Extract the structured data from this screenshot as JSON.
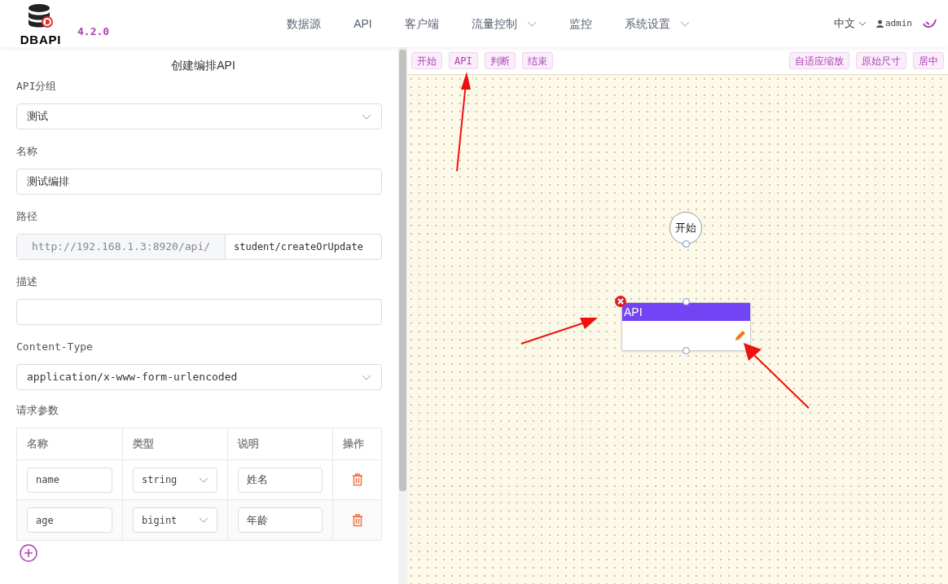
{
  "header": {
    "logo_text": "DBAPI",
    "version": "4.2.0",
    "nav": [
      {
        "label": "数据源",
        "dropdown": false
      },
      {
        "label": "API",
        "dropdown": false
      },
      {
        "label": "客户端",
        "dropdown": false
      },
      {
        "label": "流量控制",
        "dropdown": true
      },
      {
        "label": "监控",
        "dropdown": false
      },
      {
        "label": "系统设置",
        "dropdown": true
      }
    ],
    "language": "中文",
    "user": "admin"
  },
  "form": {
    "title": "创建编排API",
    "fields": [
      {
        "kind": "select",
        "label": "API分组",
        "value": "测试"
      },
      {
        "kind": "input",
        "label": "名称",
        "value": "测试编排"
      },
      {
        "kind": "path",
        "label": "路径",
        "prefix": "http://192.168.1.3:8920/api/",
        "value": "student/createOrUpdate"
      },
      {
        "kind": "input",
        "label": "描述"
      },
      {
        "kind": "select",
        "label": "Content-Type",
        "value": "application/x-www-form-urlencoded"
      }
    ],
    "params_label": "请求参数",
    "params_columns": [
      "名称",
      "类型",
      "说明",
      "操作"
    ],
    "params": [
      {
        "name": "name",
        "type": "string",
        "description": "姓名"
      },
      {
        "name": "age",
        "type": "bigint",
        "description": "年龄"
      }
    ]
  },
  "canvas": {
    "toolbar_left": [
      "开始",
      "API",
      "判断",
      "结束"
    ],
    "toolbar_right": [
      "自适应缩放",
      "原始尺寸",
      "居中"
    ],
    "nodes": [
      {
        "kind": "start",
        "label": "开始"
      },
      {
        "kind": "api",
        "label": "API"
      }
    ]
  }
}
